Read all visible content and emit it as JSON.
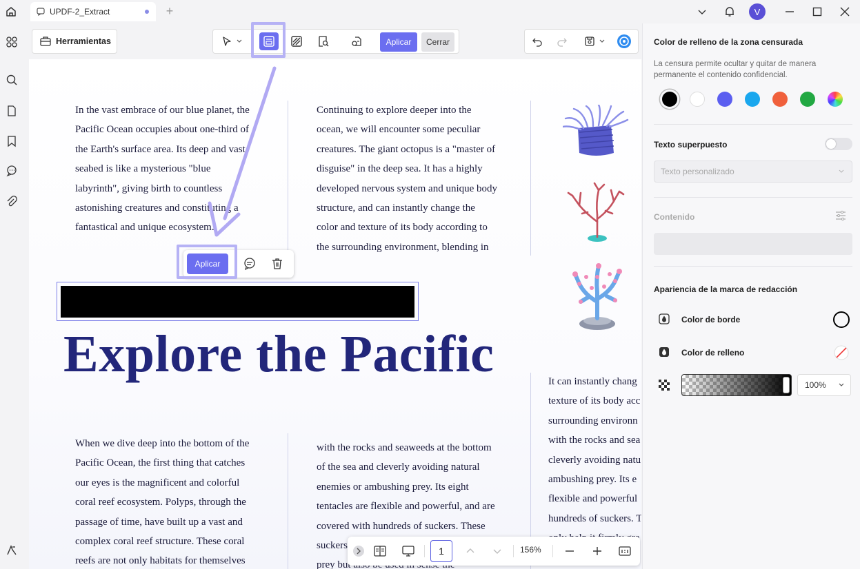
{
  "tab": {
    "title": "UPDF-2_Extract"
  },
  "user": {
    "initial": "V"
  },
  "toolbar": {
    "tools_label": "Herramientas",
    "apply_label": "Aplicar",
    "close_label": "Cerrar"
  },
  "document": {
    "col1_top": "In the vast embrace of our blue planet, the\nPacific Ocean occupies about one-third of\nthe Earth's surface area. Its deep and vast\nseabed is like a mysterious \"blue\nlabyrinth\", giving birth to countless\nastonishing creatures and constituting a\nfantastical and unique ecosystem.",
    "col2_top": "Continuing to explore deeper into the\nocean, we will encounter some peculiar\ncreatures. The giant octopus is a \"master of\ndisguise\" in the deep sea. It has a highly\ndeveloped nervous system and unique body\nstructure, and can instantly change the\ncolor and texture of its body according to\nthe surrounding environment, blending in",
    "title": "Explore the Pacific",
    "col3_mid": "It can instantly chang\ntexture of its body acc\nsurrounding environn\nwith the rocks and sea\ncleverly avoiding natu\nambushing prey. Its e\nflexible and powerful\nhundreds of suckers. T\nonly help it firmly gra",
    "col1_bottom": "When we dive deep into the bottom of the\nPacific Ocean, the first thing that catches\nour eyes is the magnificent and colorful\ncoral reef ecosystem. Polyps, through the\npassage of time, have built up a vast and\ncomplex coral reef structure. These coral\nreefs are not only habitats for themselves",
    "col2_bottom": "with the rocks and seaweeds at the bottom\nof the sea and cleverly avoiding natural\nenemies or ambushing prey. Its eight\ntentacles are flexible and powerful, and are\ncovered with hundreds of suckers. These\nsuckers\nprey but also be used in sense the"
  },
  "floating_toolbar": {
    "apply_label": "Aplicar"
  },
  "bottom_bar": {
    "page_number": "1",
    "zoom": "156%"
  },
  "panel": {
    "fill_title": "Color de relleno de la zona censurada",
    "fill_desc": "La censura permite ocultar y quitar de manera permanente el contenido confidencial.",
    "swatches": [
      "#000000",
      "#ffffff",
      "#5b5ef0",
      "#1aa7ee",
      "#f0603c",
      "#22a843",
      "rainbow"
    ],
    "overlay_title": "Texto superpuesto",
    "overlay_placeholder": "Texto personalizado",
    "content_label": "Contenido",
    "appearance_title": "Apariencia de la marca de redacción",
    "border_color_label": "Color de borde",
    "fill_color_label": "Color de relleno",
    "opacity": "100%"
  },
  "colors": {
    "accent": "#6b6ef0",
    "highlight": "#b6b2f5",
    "title_navy": "#22267a"
  }
}
